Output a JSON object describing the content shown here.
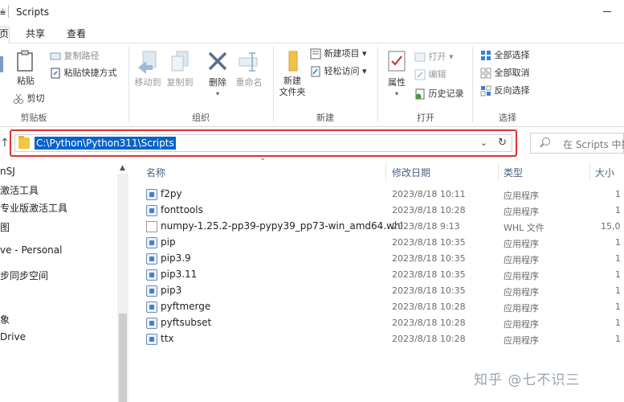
{
  "window": {
    "title": "Scripts"
  },
  "ribbon_tabs": [
    {
      "label": "页"
    },
    {
      "label": "共享"
    },
    {
      "label": "查看"
    }
  ],
  "ribbon": {
    "clipboard": {
      "group_label": "剪贴板",
      "paste": "粘贴",
      "copy_path": "复制路径",
      "paste_shortcut": "粘贴快捷方式",
      "cut": "剪切"
    },
    "organize": {
      "group_label": "组织",
      "move_to": "移动到",
      "copy_to": "复制到",
      "delete": "删除",
      "rename": "重命名"
    },
    "new": {
      "group_label": "新建",
      "new_folder": "新建\n文件夹",
      "new_item": "新建项目 ▾",
      "easy_access": "轻松访问 ▾"
    },
    "open": {
      "group_label": "打开",
      "properties": "属性",
      "open": "打开 ▾",
      "edit": "编辑",
      "history": "历史记录"
    },
    "select": {
      "group_label": "选择",
      "select_all": "全部选择",
      "select_none": "全部取消",
      "invert": "反向选择"
    }
  },
  "address": {
    "path": "C:\\Python\\Python311\\Scripts",
    "search_placeholder": "在 Scripts 中搜"
  },
  "nav": {
    "items": [
      "nSJ",
      "激活工具",
      "专业版激活工具",
      "图",
      "ve - Personal",
      "步同步空间",
      "象",
      "Drive"
    ]
  },
  "columns": {
    "name": "名称",
    "date": "修改日期",
    "type": "类型",
    "size": "大小"
  },
  "files": [
    {
      "name": "f2py",
      "date": "2023/8/18 10:11",
      "type": "应用程序",
      "size": "1",
      "icon": "exe-icon"
    },
    {
      "name": "fonttools",
      "date": "2023/8/18 10:28",
      "type": "应用程序",
      "size": "1",
      "icon": "exe-icon"
    },
    {
      "name": "numpy-1.25.2-pp39-pypy39_pp73-win_amd64.whl",
      "date": "2023/8/18 9:13",
      "type": "WHL 文件",
      "size": "15,0",
      "icon": "file-icon"
    },
    {
      "name": "pip",
      "date": "2023/8/18 10:35",
      "type": "应用程序",
      "size": "1",
      "icon": "exe-icon"
    },
    {
      "name": "pip3.9",
      "date": "2023/8/18 10:35",
      "type": "应用程序",
      "size": "1",
      "icon": "exe-icon"
    },
    {
      "name": "pip3.11",
      "date": "2023/8/18 10:35",
      "type": "应用程序",
      "size": "1",
      "icon": "exe-icon"
    },
    {
      "name": "pip3",
      "date": "2023/8/18 10:35",
      "type": "应用程序",
      "size": "1",
      "icon": "exe-icon"
    },
    {
      "name": "pyftmerge",
      "date": "2023/8/18 10:28",
      "type": "应用程序",
      "size": "1",
      "icon": "exe-icon"
    },
    {
      "name": "pyftsubset",
      "date": "2023/8/18 10:28",
      "type": "应用程序",
      "size": "1",
      "icon": "exe-icon"
    },
    {
      "name": "ttx",
      "date": "2023/8/18 10:28",
      "type": "应用程序",
      "size": "1",
      "icon": "exe-icon"
    }
  ],
  "watermark": "知乎 @七不识三",
  "colors": {
    "address_highlight": "#e03030",
    "selection": "#0a64c8"
  }
}
